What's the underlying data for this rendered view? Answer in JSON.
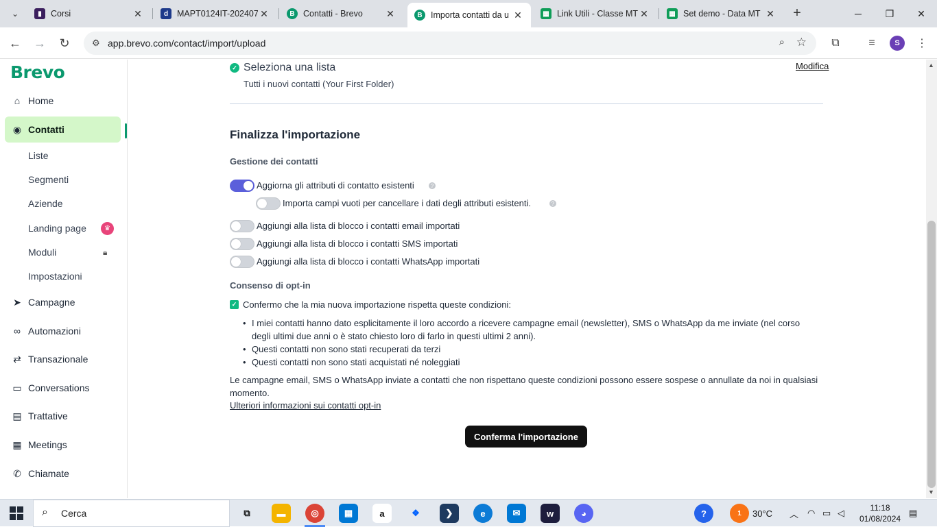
{
  "browser": {
    "tabs": [
      {
        "title": "Corsi",
        "icon": "twitch-icon",
        "color": "#6441a5"
      },
      {
        "title": "MAPT0124IT-202407",
        "icon": "docebo-icon",
        "color": "#1e3a8a"
      },
      {
        "title": "Contatti - Brevo",
        "icon": "brevo-icon",
        "color": "#0b996e"
      },
      {
        "title": "Importa contatti da u",
        "icon": "brevo-icon",
        "color": "#0b996e"
      },
      {
        "title": "Link Utili - Classe MT",
        "icon": "sheets-icon",
        "color": "#0f9d58"
      },
      {
        "title": "Set demo - Data MT",
        "icon": "sheets-icon",
        "color": "#0f9d58"
      }
    ],
    "active_tab": 3,
    "url": "app.brevo.com/contact/import/upload",
    "profile_initial": "S"
  },
  "sidebar": {
    "logo": "Brevo",
    "items": [
      {
        "label": "Home",
        "icon": "home-icon"
      },
      {
        "label": "Contatti",
        "icon": "contacts-icon",
        "active": true
      },
      {
        "label": "Liste",
        "sub": true
      },
      {
        "label": "Segmenti",
        "sub": true
      },
      {
        "label": "Aziende",
        "sub": true
      },
      {
        "label": "Landing page",
        "sub": true,
        "badge": "crown-icon"
      },
      {
        "label": "Moduli",
        "sub": true,
        "badge": "lock-icon"
      },
      {
        "label": "Impostazioni",
        "sub": true
      },
      {
        "label": "Campagne",
        "icon": "send-icon"
      },
      {
        "label": "Automazioni",
        "icon": "automation-icon"
      },
      {
        "label": "Transazionale",
        "icon": "transactional-icon"
      },
      {
        "label": "Conversations",
        "icon": "chat-icon"
      },
      {
        "label": "Trattative",
        "icon": "deals-icon"
      },
      {
        "label": "Meetings",
        "icon": "calendar-icon"
      },
      {
        "label": "Chiamate",
        "icon": "phone-icon"
      }
    ]
  },
  "main": {
    "select_list": {
      "title": "Seleziona una lista",
      "subtitle": "Tutti i nuovi contatti (Your First Folder)",
      "edit_label": "Modifica"
    },
    "finalize_title": "Finalizza l'importazione",
    "contacts_management": {
      "heading": "Gestione dei contatti",
      "options": [
        {
          "label": "Aggiorna gli attributi di contatto esistenti",
          "on": true,
          "help": true
        },
        {
          "label": "Importa campi vuoti per cancellare i dati degli attributi esistenti.",
          "on": false,
          "help": true,
          "indent": true
        },
        {
          "label": "Aggiungi alla lista di blocco i contatti email importati",
          "on": false
        },
        {
          "label": "Aggiungi alla lista di blocco i contatti SMS importati",
          "on": false
        },
        {
          "label": "Aggiungi alla lista di blocco i contatti WhatsApp importati",
          "on": false
        }
      ]
    },
    "optin": {
      "heading": "Consenso di opt-in",
      "confirm_label": "Confermo che la mia nuova importazione rispetta queste condizioni:",
      "checked": true,
      "conditions": [
        "I miei contatti hanno dato esplicitamente il loro accordo a ricevere campagne email (newsletter), SMS o WhatsApp da me inviate (nel corso degli ultimi due anni o è stato chiesto loro di farlo in questi ultimi 2 anni).",
        "Questi contatti non sono stati recuperati da terzi",
        "Questi contatti non sono stati acquistati né noleggiati"
      ],
      "warning": "Le campagne email, SMS o WhatsApp inviate a contatti che non rispettano queste condizioni possono essere sospese o annullate da noi in qualsiasi momento.",
      "more_link": "Ulteriori informazioni sui contatti opt-in"
    },
    "confirm_button": "Conferma l'importazione"
  },
  "taskbar": {
    "search_placeholder": "Cerca",
    "weather": "30°C",
    "weather_badge": "1",
    "time": "11:18",
    "date": "01/08/2024"
  },
  "colors": {
    "brand": "#0b996e",
    "active_nav_bg": "#d4f7c9",
    "toggle_on": "#5b5fdb",
    "check": "#10b981",
    "button": "#111111"
  }
}
